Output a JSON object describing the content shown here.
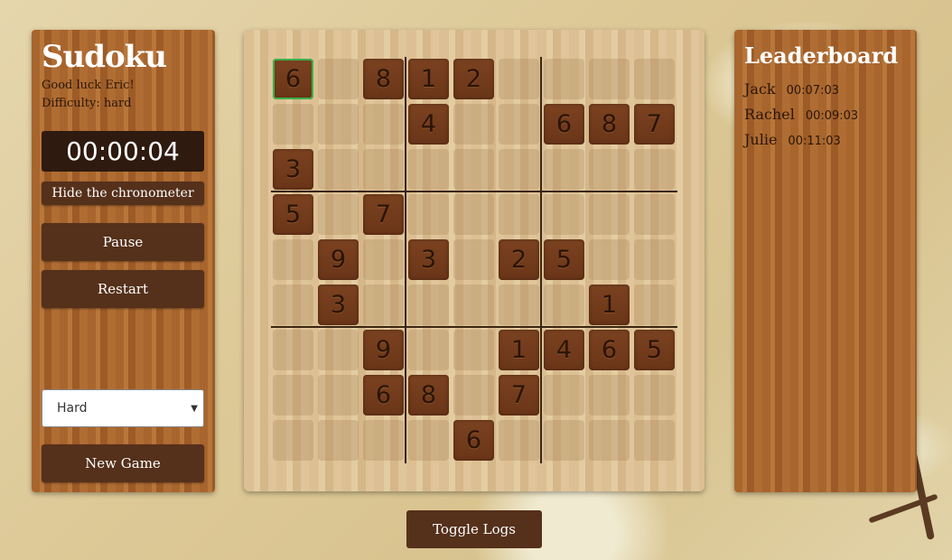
{
  "sidebar": {
    "title": "Sudoku",
    "greeting": "Good luck Eric!",
    "difficulty_text": "Difficulty: hard",
    "timer": "00:00:04",
    "hide_chrono_label": "Hide the chronometer",
    "pause_label": "Pause",
    "restart_label": "Restart",
    "difficulty_select": "Hard",
    "new_game_label": "New Game"
  },
  "board": {
    "selected": [
      0,
      0
    ],
    "rows": [
      [
        "6",
        "",
        "8",
        "1",
        "2",
        "",
        "",
        "",
        ""
      ],
      [
        "",
        "",
        "",
        "4",
        "",
        "",
        "6",
        "8",
        "7"
      ],
      [
        "3",
        "",
        "",
        "",
        "",
        "",
        "",
        "",
        ""
      ],
      [
        "5",
        "",
        "7",
        "",
        "",
        "",
        "",
        "",
        ""
      ],
      [
        "",
        "9",
        "",
        "3",
        "",
        "2",
        "5",
        "",
        ""
      ],
      [
        "",
        "3",
        "",
        "",
        "",
        "",
        "",
        "1",
        ""
      ],
      [
        "",
        "",
        "9",
        "",
        "",
        "1",
        "4",
        "6",
        "5"
      ],
      [
        "",
        "",
        "6",
        "8",
        "",
        "7",
        "",
        "",
        ""
      ],
      [
        "",
        "",
        "",
        "",
        "6",
        "",
        "",
        "",
        ""
      ]
    ]
  },
  "leaderboard": {
    "title": "Leaderboard",
    "entries": [
      {
        "name": "Jack",
        "time": "00:07:03"
      },
      {
        "name": "Rachel",
        "time": "00:09:03"
      },
      {
        "name": "Julie",
        "time": "00:11:03"
      }
    ]
  },
  "footer": {
    "toggle_logs_label": "Toggle Logs"
  },
  "colors": {
    "wood": "#a8652d",
    "button": "#55301b",
    "tile": "#6f3a1b",
    "selected_outline": "#3bb04a"
  }
}
